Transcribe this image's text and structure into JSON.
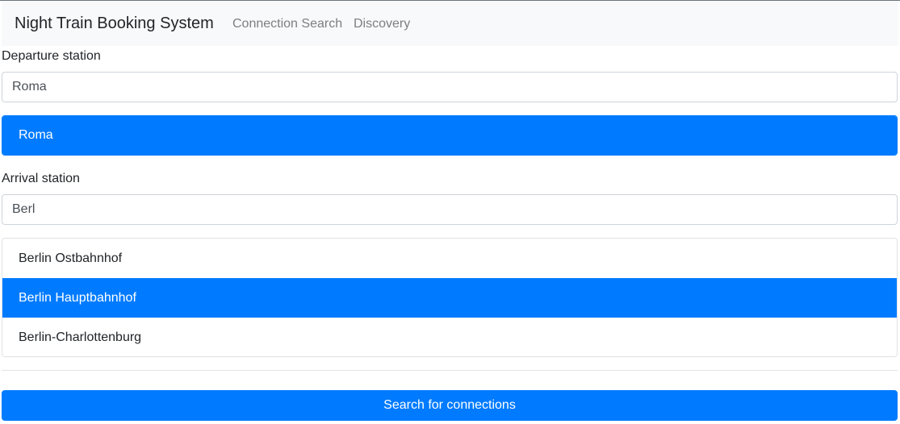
{
  "navbar": {
    "brand": "Night Train Booking System",
    "links": [
      {
        "label": "Connection Search"
      },
      {
        "label": "Discovery"
      }
    ]
  },
  "departure": {
    "label": "Departure station",
    "value": "Roma",
    "suggestions": [
      {
        "label": "Roma",
        "active": true
      }
    ]
  },
  "arrival": {
    "label": "Arrival station",
    "value": "Berl",
    "suggestions": [
      {
        "label": "Berlin Ostbahnhof",
        "active": false
      },
      {
        "label": "Berlin Hauptbahnhof",
        "active": true
      },
      {
        "label": "Berlin-Charlottenburg",
        "active": false
      }
    ]
  },
  "search": {
    "button_label": "Search for connections"
  },
  "colors": {
    "primary": "#007bff",
    "navbar_bg": "#f8f9fa"
  }
}
